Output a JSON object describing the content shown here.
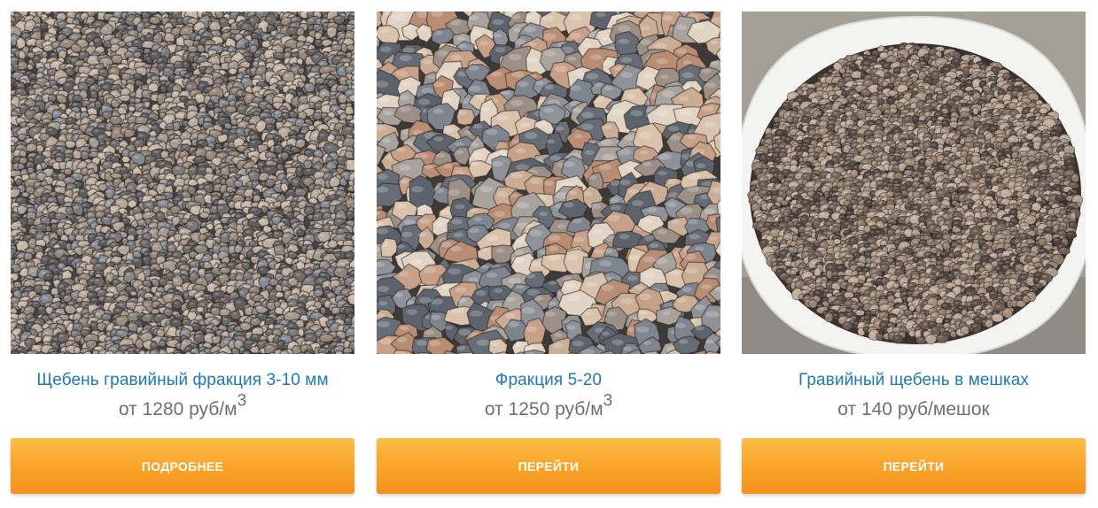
{
  "products": [
    {
      "image": "gravel-3-10-photo",
      "title": "Щебень гравийный фракция 3-10 мм",
      "price_prefix": "от",
      "price_value": "1280",
      "price_unit": "руб/м",
      "price_sup": "3",
      "button_label": "ПОДРОБНЕЕ"
    },
    {
      "image": "gravel-5-20-photo",
      "title": "Фракция 5-20",
      "price_prefix": "от",
      "price_value": "1250",
      "price_unit": "руб/м",
      "price_sup": "3",
      "button_label": "ПЕРЕЙТИ"
    },
    {
      "image": "gravel-bag-photo",
      "title": "Гравийный щебень в мешках",
      "price_prefix": "от",
      "price_value": "140",
      "price_unit": "руб/мешок",
      "price_sup": "",
      "button_label": "ПЕРЕЙТИ"
    }
  ],
  "colors": {
    "link": "#1d78c1",
    "price": "#6f6f6f",
    "button_top": "#fbbd46",
    "button_bottom": "#f5901c",
    "button_text": "#ffffff"
  }
}
